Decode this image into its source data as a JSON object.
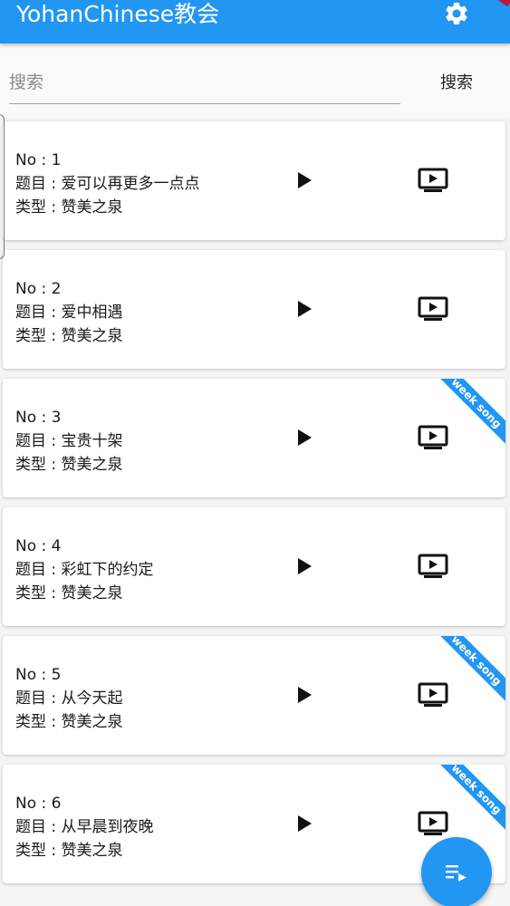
{
  "app_title": "YohanChinese教会",
  "icons": {
    "settings": "gear-icon",
    "play": "play-icon",
    "video": "video-player-icon",
    "fab": "playlist-icon"
  },
  "colors": {
    "primary": "#2196f3",
    "debug_banner": "#b71c3b"
  },
  "search": {
    "placeholder": "搜索",
    "value": "",
    "button_label": "搜索"
  },
  "songs": [
    {
      "no": "No : 1",
      "title": "题目 : 爱可以再更多一点点",
      "type": "类型 : 赞美之泉",
      "week_song": ""
    },
    {
      "no": "No : 2",
      "title": "题目 : 爱中相遇",
      "type": "类型 : 赞美之泉",
      "week_song": ""
    },
    {
      "no": "No : 3",
      "title": "题目 : 宝贵十架",
      "type": "类型 : 赞美之泉",
      "week_song": "week song"
    },
    {
      "no": "No : 4",
      "title": "题目 : 彩虹下的约定",
      "type": "类型 : 赞美之泉",
      "week_song": ""
    },
    {
      "no": "No : 5",
      "title": "题目 : 从今天起",
      "type": "类型 : 赞美之泉",
      "week_song": "week song"
    },
    {
      "no": "No : 6",
      "title": "题目 : 从早晨到夜晚",
      "type": "类型 : 赞美之泉",
      "week_song": "week song"
    }
  ]
}
